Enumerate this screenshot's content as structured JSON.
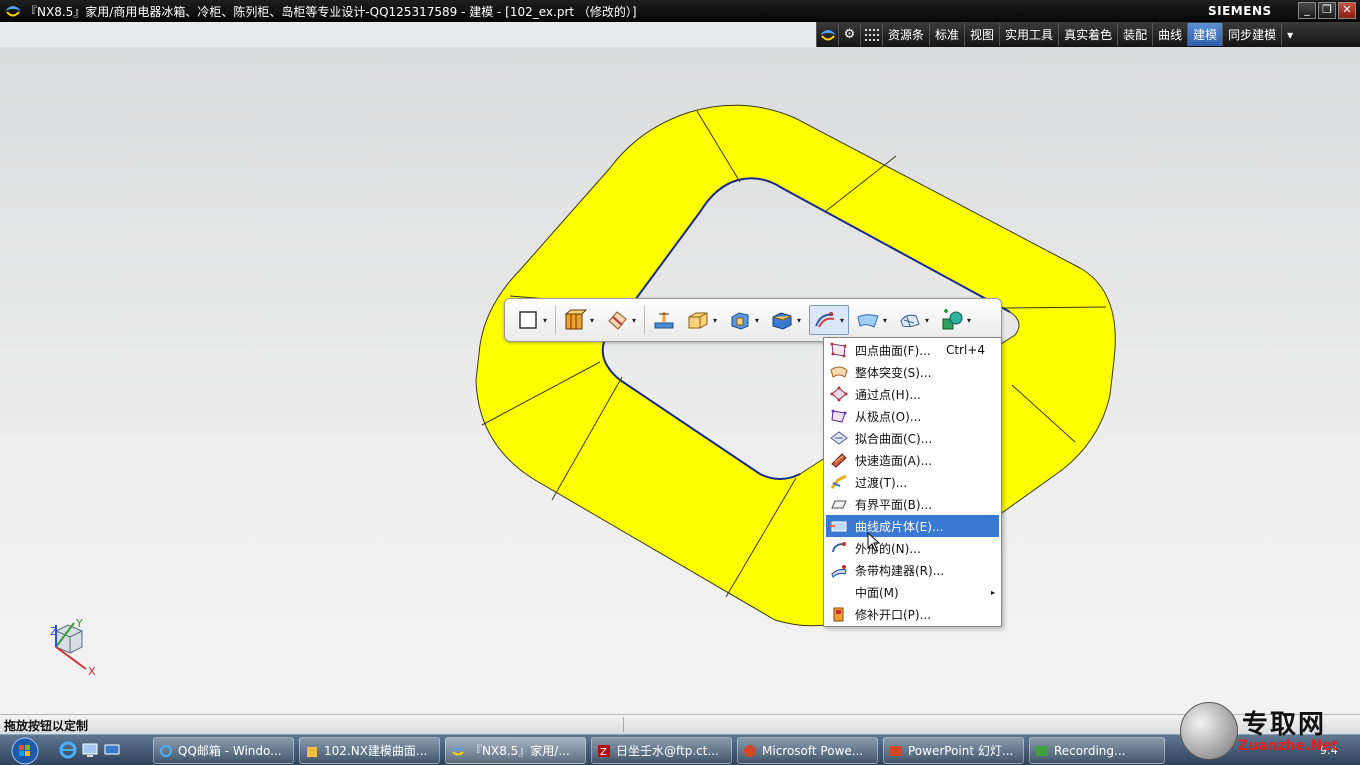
{
  "window": {
    "title": "『NX8.5』家用/商用电器冰箱、冷柜、陈列柜、岛柜等专业设计-QQ125317589 - 建模 - [102_ex.prt （修改的）]",
    "brand": "SIEMENS",
    "controls": [
      "_",
      "❐",
      "✕"
    ]
  },
  "menubar": {
    "items": [
      {
        "label": "资源条",
        "active": false
      },
      {
        "label": "标准",
        "active": false
      },
      {
        "label": "视图",
        "active": false
      },
      {
        "label": "实用工具",
        "active": false
      },
      {
        "label": "真实着色",
        "active": false
      },
      {
        "label": "装配",
        "active": false
      },
      {
        "label": "曲线",
        "active": false
      },
      {
        "label": "建模",
        "active": true
      },
      {
        "label": "同步建模",
        "active": false
      }
    ],
    "overflow_icon": "▾"
  },
  "toolbar": {
    "dropdown_arrow": "▾",
    "buttons": [
      "sketch-icon",
      "extrude-body-icon",
      "trim-icon",
      "datum-icon",
      "block-icon",
      "boolean-icon",
      "shell-icon",
      "surface-icon",
      "sheet-icon",
      "mesh-icon",
      "feature-icon"
    ]
  },
  "dropdown": {
    "items": [
      {
        "label": "四点曲面(F)...",
        "shortcut": "Ctrl+4",
        "icon": "four-point-surface-icon",
        "highlight": false
      },
      {
        "label": "整体突变(S)...",
        "shortcut": "",
        "icon": "global-shaping-icon",
        "highlight": false
      },
      {
        "label": "通过点(H)...",
        "shortcut": "",
        "icon": "through-points-icon",
        "highlight": false
      },
      {
        "label": "从极点(O)...",
        "shortcut": "",
        "icon": "from-poles-icon",
        "highlight": false
      },
      {
        "label": "拟合曲面(C)...",
        "shortcut": "",
        "icon": "fit-surface-icon",
        "highlight": false
      },
      {
        "label": "快速造面(A)...",
        "shortcut": "",
        "icon": "rapid-surfacing-icon",
        "highlight": false
      },
      {
        "label": "过渡(T)...",
        "shortcut": "",
        "icon": "transition-icon",
        "highlight": false
      },
      {
        "label": "有界平面(B)...",
        "shortcut": "",
        "icon": "bounded-plane-icon",
        "highlight": false
      },
      {
        "label": "曲线成片体(E)...",
        "shortcut": "",
        "icon": "sheets-from-curves-icon",
        "highlight": true
      },
      {
        "label": "外形的(N)...",
        "shortcut": "",
        "icon": "swoop-icon",
        "highlight": false
      },
      {
        "label": "条带构建器(R)...",
        "shortcut": "",
        "icon": "ribbon-builder-icon",
        "highlight": false
      },
      {
        "label": "中面(M)",
        "shortcut": "",
        "icon": "",
        "highlight": false,
        "submenu": true
      },
      {
        "label": "修补开口(P)...",
        "shortcut": "",
        "icon": "patch-openings-icon",
        "highlight": false
      }
    ],
    "submenu_arrow": "▸"
  },
  "triad": {
    "x": "X",
    "y": "Y",
    "z": "Z"
  },
  "status": {
    "text": "拖放按钮以定制"
  },
  "taskbar": {
    "tasks": [
      {
        "label": "QQ邮箱 - Windo...",
        "icon": "ie-icon"
      },
      {
        "label": "102.NX建模曲面...",
        "icon": "folder-icon"
      },
      {
        "label": "『NX8.5』家用/...",
        "icon": "nx-icon"
      },
      {
        "label": "日坐壬水@ftp.ct...",
        "icon": "filezilla-icon"
      },
      {
        "label": "Microsoft Powe...",
        "icon": "powerpoint-icon"
      },
      {
        "label": "PowerPoint 幻灯...",
        "icon": "powerpoint-slide-icon"
      },
      {
        "label": "Recording...",
        "icon": "recording-icon"
      }
    ],
    "clock": "9:4"
  },
  "watermark": {
    "cn": "专取网",
    "en": "Zuanzhe.Net"
  },
  "colors": {
    "part_fill": "#ffff00",
    "menu_highlight": "#3b78d4",
    "active_tab": "#2e5ea8"
  }
}
